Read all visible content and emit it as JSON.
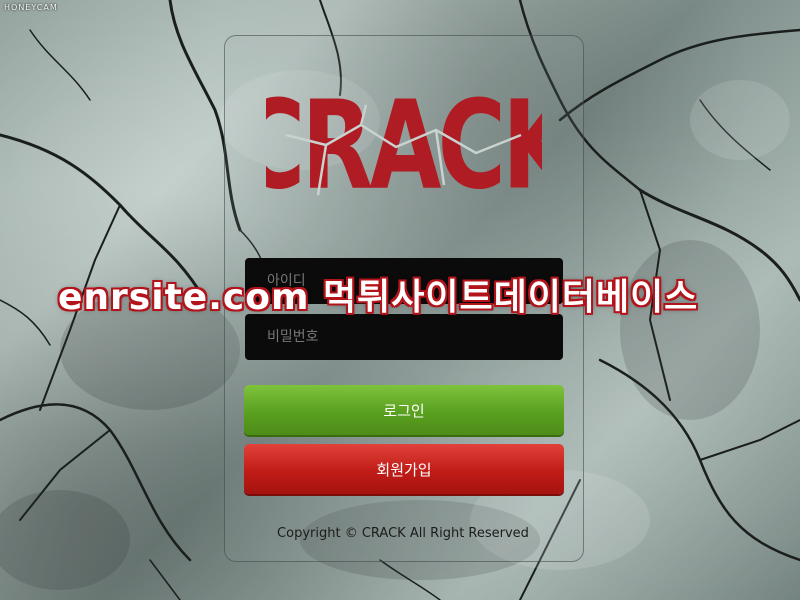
{
  "watermark": {
    "capture_label": "HONEYCAM"
  },
  "brand": {
    "logo_text": "CRACK",
    "logo_color": "#b01c24"
  },
  "login_form": {
    "id_placeholder": "아이디",
    "password_placeholder": "비밀번호",
    "login_button": "로그인",
    "join_button": "회원가입"
  },
  "footer": {
    "copyright": "Copyright © CRACK All Right Reserved"
  },
  "overlay": {
    "banner_text": "enrsite.com 먹튀사이트데이터베이스"
  },
  "colors": {
    "login_green": "#5aa020",
    "join_red": "#c01c17",
    "field_bg": "#0b0b0b"
  }
}
